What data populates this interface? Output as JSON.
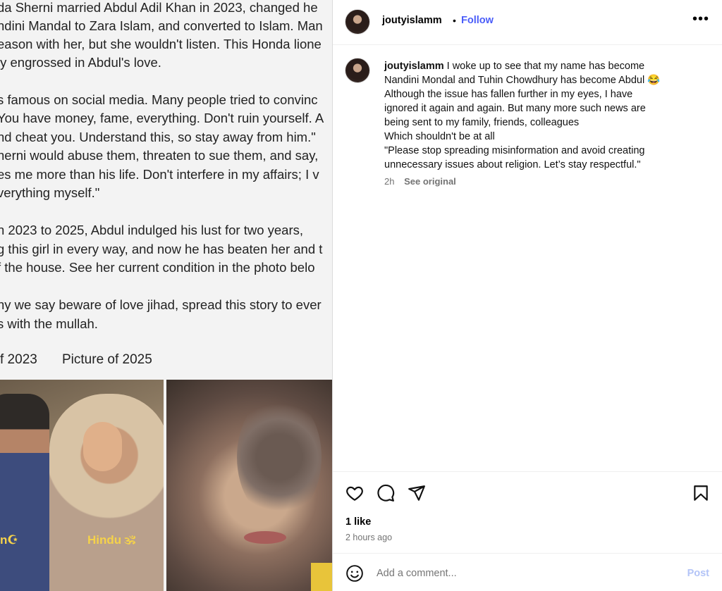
{
  "left_panel": {
    "lines": [
      "da Sherni married Abdul Adil Khan in 2023, changed he",
      "ndini Mandal to Zara Islam, and converted to Islam. Man",
      "eason with her, but she wouldn't listen. This Honda lione",
      "ly engrossed in Abdul's love.",
      "s famous on social media. Many people tried to convinc",
      "You have money, fame, everything. Don't ruin yourself. A",
      "nd cheat you. Understand this, so stay away from him.\"",
      "herni would abuse them, threaten to sue them, and say,",
      "es me more than his life. Don't interfere in my affairs; I v",
      "verything myself.\"",
      "n 2023 to 2025, Abdul indulged his lust for two years,",
      "g this girl in every way, and now he has beaten her and t",
      "f the house. See her current condition in the photo belo",
      "hy we say beware of love jihad, spread this story to ever",
      "s with the mullah."
    ],
    "caption_left": "f 2023",
    "caption_right": "Picture of 2025",
    "tag_left": "n☪",
    "tag_hindu": "Hindu 🕉"
  },
  "header": {
    "username": "joutyislamm",
    "separator": "•",
    "follow_label": "Follow",
    "more_label": "•••"
  },
  "caption": {
    "username": "joutyislamm",
    "text_lines": [
      "I woke up to see that my name has become",
      "Nandini Mondal and Tuhin Chowdhury has become Abdul 😂",
      "Although the issue has fallen further in my eyes, I have",
      "ignored it again and again. But many more such news are",
      "being sent to my family, friends, colleagues",
      "Which shouldn't be at all",
      "\"Please stop spreading misinformation and avoid creating",
      "unnecessary issues about religion. Let’s stay respectful.\""
    ],
    "time": "2h",
    "see_original": "See original"
  },
  "actions": {
    "icons": [
      "heart-icon",
      "comment-icon",
      "share-icon",
      "bookmark-icon"
    ],
    "likes": "1 like",
    "time_ago": "2 hours ago"
  },
  "comment": {
    "placeholder": "Add a comment...",
    "post_label": "Post"
  },
  "colors": {
    "follow": "#4a5df9",
    "post_disabled": "#b3c4f7",
    "muted": "#737373"
  }
}
